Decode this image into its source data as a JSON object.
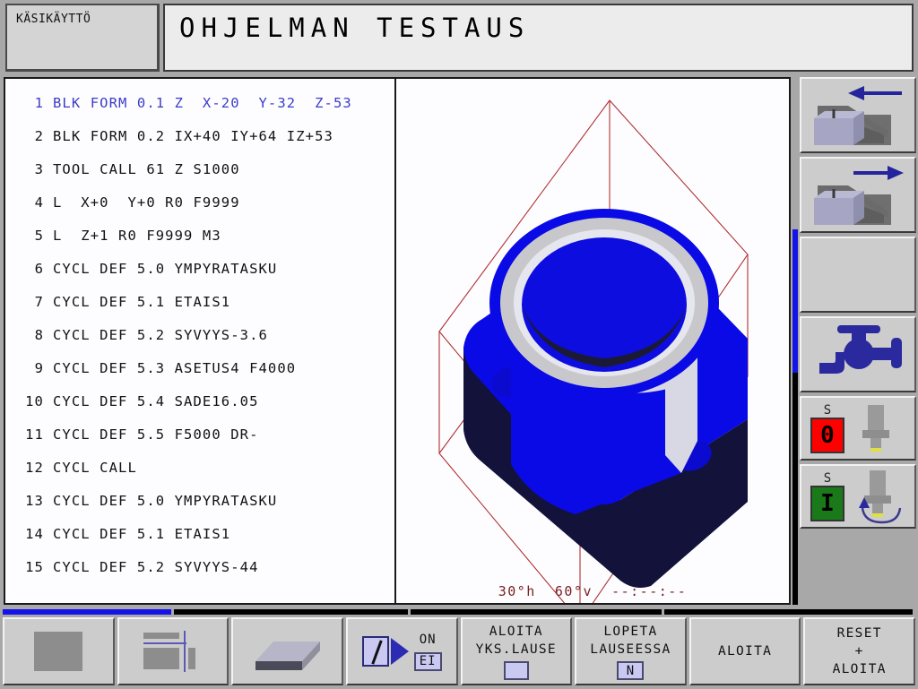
{
  "header": {
    "mode_label": "KÄSIKÄYTTÖ",
    "title": "OHJELMAN TESTAUS"
  },
  "program": {
    "lines": [
      {
        "num": "1",
        "text": "BLK FORM 0.1 Z  X-20  Y-32  Z-53",
        "cursor": true
      },
      {
        "num": "2",
        "text": "BLK FORM 0.2 IX+40 IY+64 IZ+53",
        "cursor": false
      },
      {
        "num": "3",
        "text": "TOOL CALL 61 Z S1000",
        "cursor": false
      },
      {
        "num": "4",
        "text": "L  X+0  Y+0 R0 F9999",
        "cursor": false
      },
      {
        "num": "5",
        "text": "L  Z+1 R0 F9999 M3",
        "cursor": false
      },
      {
        "num": "6",
        "text": "CYCL DEF 5.0 YMPYRATASKU",
        "cursor": false
      },
      {
        "num": "7",
        "text": "CYCL DEF 5.1 ETAIS1",
        "cursor": false
      },
      {
        "num": "8",
        "text": "CYCL DEF 5.2 SYVYYS-3.6",
        "cursor": false
      },
      {
        "num": "9",
        "text": "CYCL DEF 5.3 ASETUS4 F4000",
        "cursor": false
      },
      {
        "num": "10",
        "text": "CYCL DEF 5.4 SADE16.05",
        "cursor": false
      },
      {
        "num": "11",
        "text": "CYCL DEF 5.5 F5000 DR-",
        "cursor": false
      },
      {
        "num": "12",
        "text": "CYCL CALL",
        "cursor": false
      },
      {
        "num": "13",
        "text": "CYCL DEF 5.0 YMPYRATASKU",
        "cursor": false
      },
      {
        "num": "14",
        "text": "CYCL DEF 5.1 ETAIS1",
        "cursor": false
      },
      {
        "num": "15",
        "text": "CYCL DEF 5.2 SYVYYS-44",
        "cursor": false
      }
    ],
    "cursor_color": "#3c3cc8"
  },
  "simulation": {
    "status_text": "30°h  60°v  --:--:--",
    "status_color": "#7a2020",
    "rotation_h": "30°h",
    "rotation_v": "60°v",
    "elapsed_time": "--:--:--",
    "workpiece_color": "#0a0ae6",
    "machined_color": "#d8d8e4",
    "blank_outline_color": "#b03030"
  },
  "right_softkeys": [
    {
      "name": "move-left",
      "icon": "arm-arrow-left-icon",
      "arrow": "left"
    },
    {
      "name": "move-right",
      "icon": "arm-arrow-right-icon",
      "arrow": "right"
    },
    {
      "name": "blank",
      "icon": "none",
      "arrow": ""
    },
    {
      "name": "coolant",
      "icon": "coolant-tap-icon",
      "arrow": ""
    }
  ],
  "spindle": {
    "stop": {
      "label": "S",
      "state": "0",
      "color": "#ff0000"
    },
    "start": {
      "label": "S",
      "state": "I",
      "color": "#1a7a1a"
    }
  },
  "bottom_softkeys": [
    {
      "type": "icon",
      "name": "view-solid",
      "icon": "filled-square-icon",
      "label": ""
    },
    {
      "type": "icon",
      "name": "view-split",
      "icon": "split-layout-icon",
      "label": ""
    },
    {
      "type": "icon",
      "name": "view-3d",
      "icon": "block-3d-icon",
      "label": ""
    },
    {
      "type": "toggle",
      "name": "skip-block",
      "icon": "slash-arrow-icon",
      "on_label": "ON",
      "value": "EI"
    },
    {
      "type": "text",
      "name": "start-single-block",
      "line1": "ALOITA",
      "line2": "YKS.LAUSE",
      "chip": ""
    },
    {
      "type": "text",
      "name": "stop-at-block",
      "line1": "LOPETA",
      "line2": "LAUSEESSA",
      "chip": "N"
    },
    {
      "type": "text",
      "name": "start",
      "line1": "ALOITA",
      "line2": "",
      "chip": null
    },
    {
      "type": "text",
      "name": "reset-start",
      "line1": "RESET",
      "line2": "+",
      "line3": "ALOITA",
      "chip": null
    }
  ],
  "scrollbar": {
    "horizontal_segments": 4,
    "horizontal_active_index": 0,
    "vertical_position": "upper"
  },
  "colors": {
    "chrome": "#a8a8a8",
    "key_face": "#cccccc",
    "panel_bg": "#fdfdff",
    "accent_blue": "#1414e6"
  }
}
